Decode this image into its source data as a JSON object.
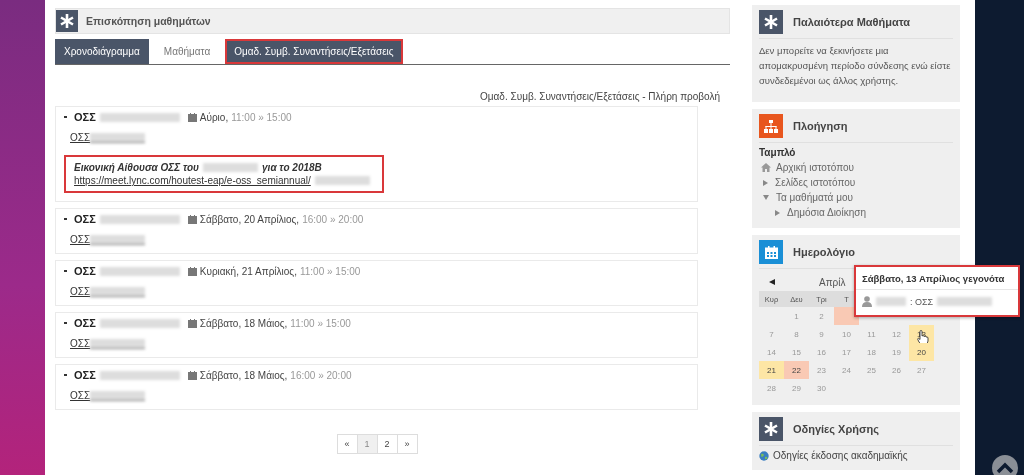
{
  "course_overview": {
    "title": "Επισκόπηση μαθημάτων",
    "tabs": [
      {
        "label": "Χρονοδιάγραμμα",
        "selected": true,
        "annotated": false
      },
      {
        "label": "Μαθήματα",
        "selected": false,
        "annotated": false
      },
      {
        "label": "Ομαδ. Συμβ. Συναντήσεις/Εξετάσεις",
        "selected": true,
        "annotated": true
      }
    ],
    "full_view": "Ομαδ. Συμβ. Συναντήσεις/Εξετάσεις - Πλήρη προβολή",
    "events": [
      {
        "title": "ΟΣΣ",
        "date": "Αύριο,",
        "time": "11:00 » 15:00",
        "link": "ΟΣΣ",
        "description": {
          "annotated": true,
          "text_before": "Εικονική Αίθουσα ΟΣΣ του",
          "text_after": "για το 2018Β",
          "url": "https://meet.lync.com/houtest-eap/e-oss_semiannual/"
        }
      },
      {
        "title": "ΟΣΣ",
        "date": "Σάββατο, 20 Απρίλιος,",
        "time": "16:00 » 20:00",
        "link": "ΟΣΣ"
      },
      {
        "title": "ΟΣΣ",
        "date": "Κυριακή, 21 Απρίλιος,",
        "time": "11:00 » 15:00",
        "link": "ΟΣΣ"
      },
      {
        "title": "ΟΣΣ",
        "date": "Σάββατο, 18 Μάιος,",
        "time": "11:00 » 15:00",
        "link": "ΟΣΣ"
      },
      {
        "title": "ΟΣΣ",
        "date": "Σάββατο, 18 Μάιος,",
        "time": "16:00 » 20:00",
        "link": "ΟΣΣ"
      }
    ],
    "pagination": [
      {
        "label": "«",
        "selected": false
      },
      {
        "label": "1",
        "selected": true
      },
      {
        "label": "2",
        "selected": false
      },
      {
        "label": "»",
        "selected": false
      }
    ]
  },
  "sidebar": [
    {
      "kind": "text",
      "title": "Παλαιότερα Μαθήματα",
      "text": "Δεν μπορείτε να ξεκινήσετε μια απομακρυσμένη περίοδο σύνδεσης ενώ είστε συνδεδεμένοι ως άλλος χρήστης."
    },
    {
      "kind": "navigation",
      "title": "Πλοήγηση",
      "heading": "Ταμπλό",
      "items": [
        {
          "kind": "home",
          "label": "Αρχική ιστοτόπου"
        },
        {
          "kind": "branch",
          "label": "Σελίδες ιστοτόπου",
          "expanded": false
        },
        {
          "kind": "branch",
          "label": "Τα μαθήματά μου",
          "expanded": true,
          "children": [
            {
              "kind": "branch",
              "label": "Δημόσια Διοίκηση",
              "expanded": false
            }
          ]
        }
      ]
    },
    {
      "kind": "calendar",
      "title": "Ημερολόγιο",
      "month": "Απρίλ",
      "weekdays": [
        "Κυρ",
        "Δευ",
        "Τρι",
        "Τ"
      ],
      "weeks": [
        [
          {
            "kind": "blank"
          },
          {
            "kind": "day",
            "day": "1"
          },
          {
            "kind": "day",
            "day": "2"
          },
          {
            "kind": "day",
            "color": "#f9c9b4"
          },
          {
            "kind": "blank"
          },
          {
            "kind": "blank"
          },
          {
            "kind": "blank"
          }
        ],
        [
          {
            "kind": "day",
            "day": "7"
          },
          {
            "kind": "day",
            "day": "8"
          },
          {
            "kind": "day",
            "day": "9"
          },
          {
            "kind": "day",
            "day": "10"
          },
          {
            "kind": "day",
            "day": "11"
          },
          {
            "kind": "day",
            "day": "12"
          },
          {
            "kind": "day",
            "day": "13",
            "color": "#fde6a5",
            "hovered": true
          }
        ],
        [
          {
            "kind": "day",
            "day": "14"
          },
          {
            "kind": "day",
            "day": "15"
          },
          {
            "kind": "day",
            "day": "16"
          },
          {
            "kind": "day",
            "day": "17"
          },
          {
            "kind": "day",
            "day": "18"
          },
          {
            "kind": "day",
            "day": "19"
          },
          {
            "kind": "day",
            "day": "20",
            "color": "#fde6a5"
          }
        ],
        [
          {
            "kind": "day",
            "day": "21",
            "color": "#fde6a5"
          },
          {
            "kind": "day",
            "day": "22",
            "color": "#f9c9b4"
          },
          {
            "kind": "day",
            "day": "23"
          },
          {
            "kind": "day",
            "day": "24"
          },
          {
            "kind": "day",
            "day": "25"
          },
          {
            "kind": "day",
            "day": "26"
          },
          {
            "kind": "day",
            "day": "27"
          }
        ],
        [
          {
            "kind": "day",
            "day": "28"
          },
          {
            "kind": "day",
            "day": "29"
          },
          {
            "kind": "day",
            "day": "30"
          },
          {
            "kind": "blank"
          },
          {
            "kind": "blank"
          },
          {
            "kind": "blank"
          },
          {
            "kind": "blank"
          }
        ]
      ],
      "tooltip": {
        "title": "Σάββατο, 13 Απρίλιος γεγονότα",
        "text": ": ΟΣΣ"
      }
    },
    {
      "kind": "links",
      "title": "Οδηγίες Χρήσης",
      "links": [
        "Οδηγίες έκδοσης ακαδημαϊκής"
      ]
    }
  ]
}
